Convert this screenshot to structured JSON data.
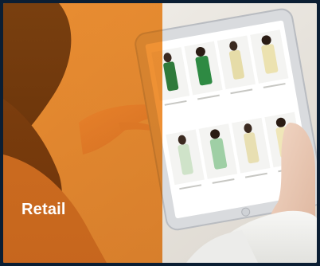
{
  "card": {
    "label": "Retail",
    "overlay_color": "#e8780c",
    "scene": {
      "icon": "tablet-shopping-photo",
      "product_thumbnails": 8
    }
  }
}
